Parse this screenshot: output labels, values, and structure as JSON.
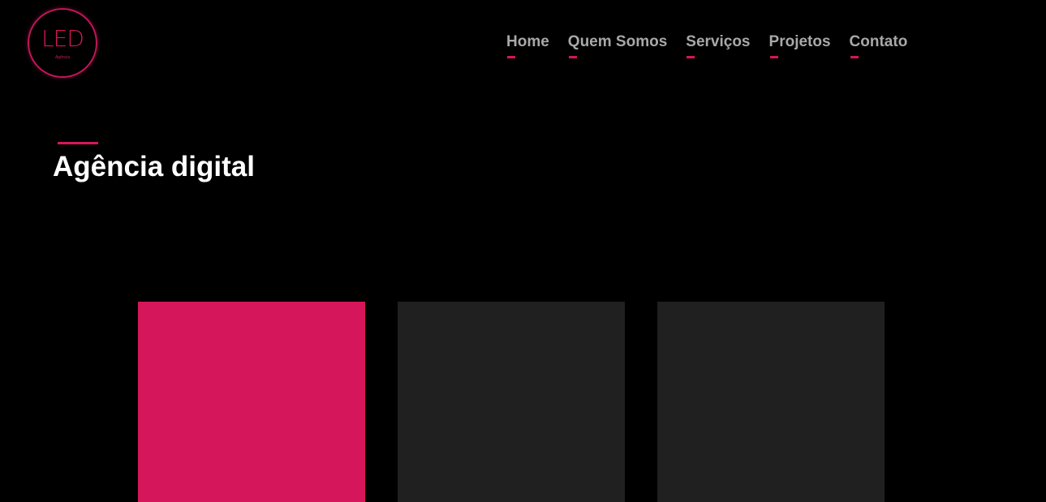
{
  "logo": {
    "text": "LED",
    "subtext": "Agência"
  },
  "nav": {
    "items": [
      {
        "label": "Home"
      },
      {
        "label": "Quem Somos"
      },
      {
        "label": "Serviços"
      },
      {
        "label": "Projetos"
      },
      {
        "label": "Contato"
      }
    ]
  },
  "hero": {
    "title": "Agência digital"
  },
  "cards": [
    {
      "color": "#d6165a"
    },
    {
      "color": "#202020"
    },
    {
      "color": "#202020"
    }
  ],
  "colors": {
    "background": "#000000",
    "accent": "#d6165a",
    "nav_text": "#a8a8a8",
    "title_text": "#ffffff"
  }
}
